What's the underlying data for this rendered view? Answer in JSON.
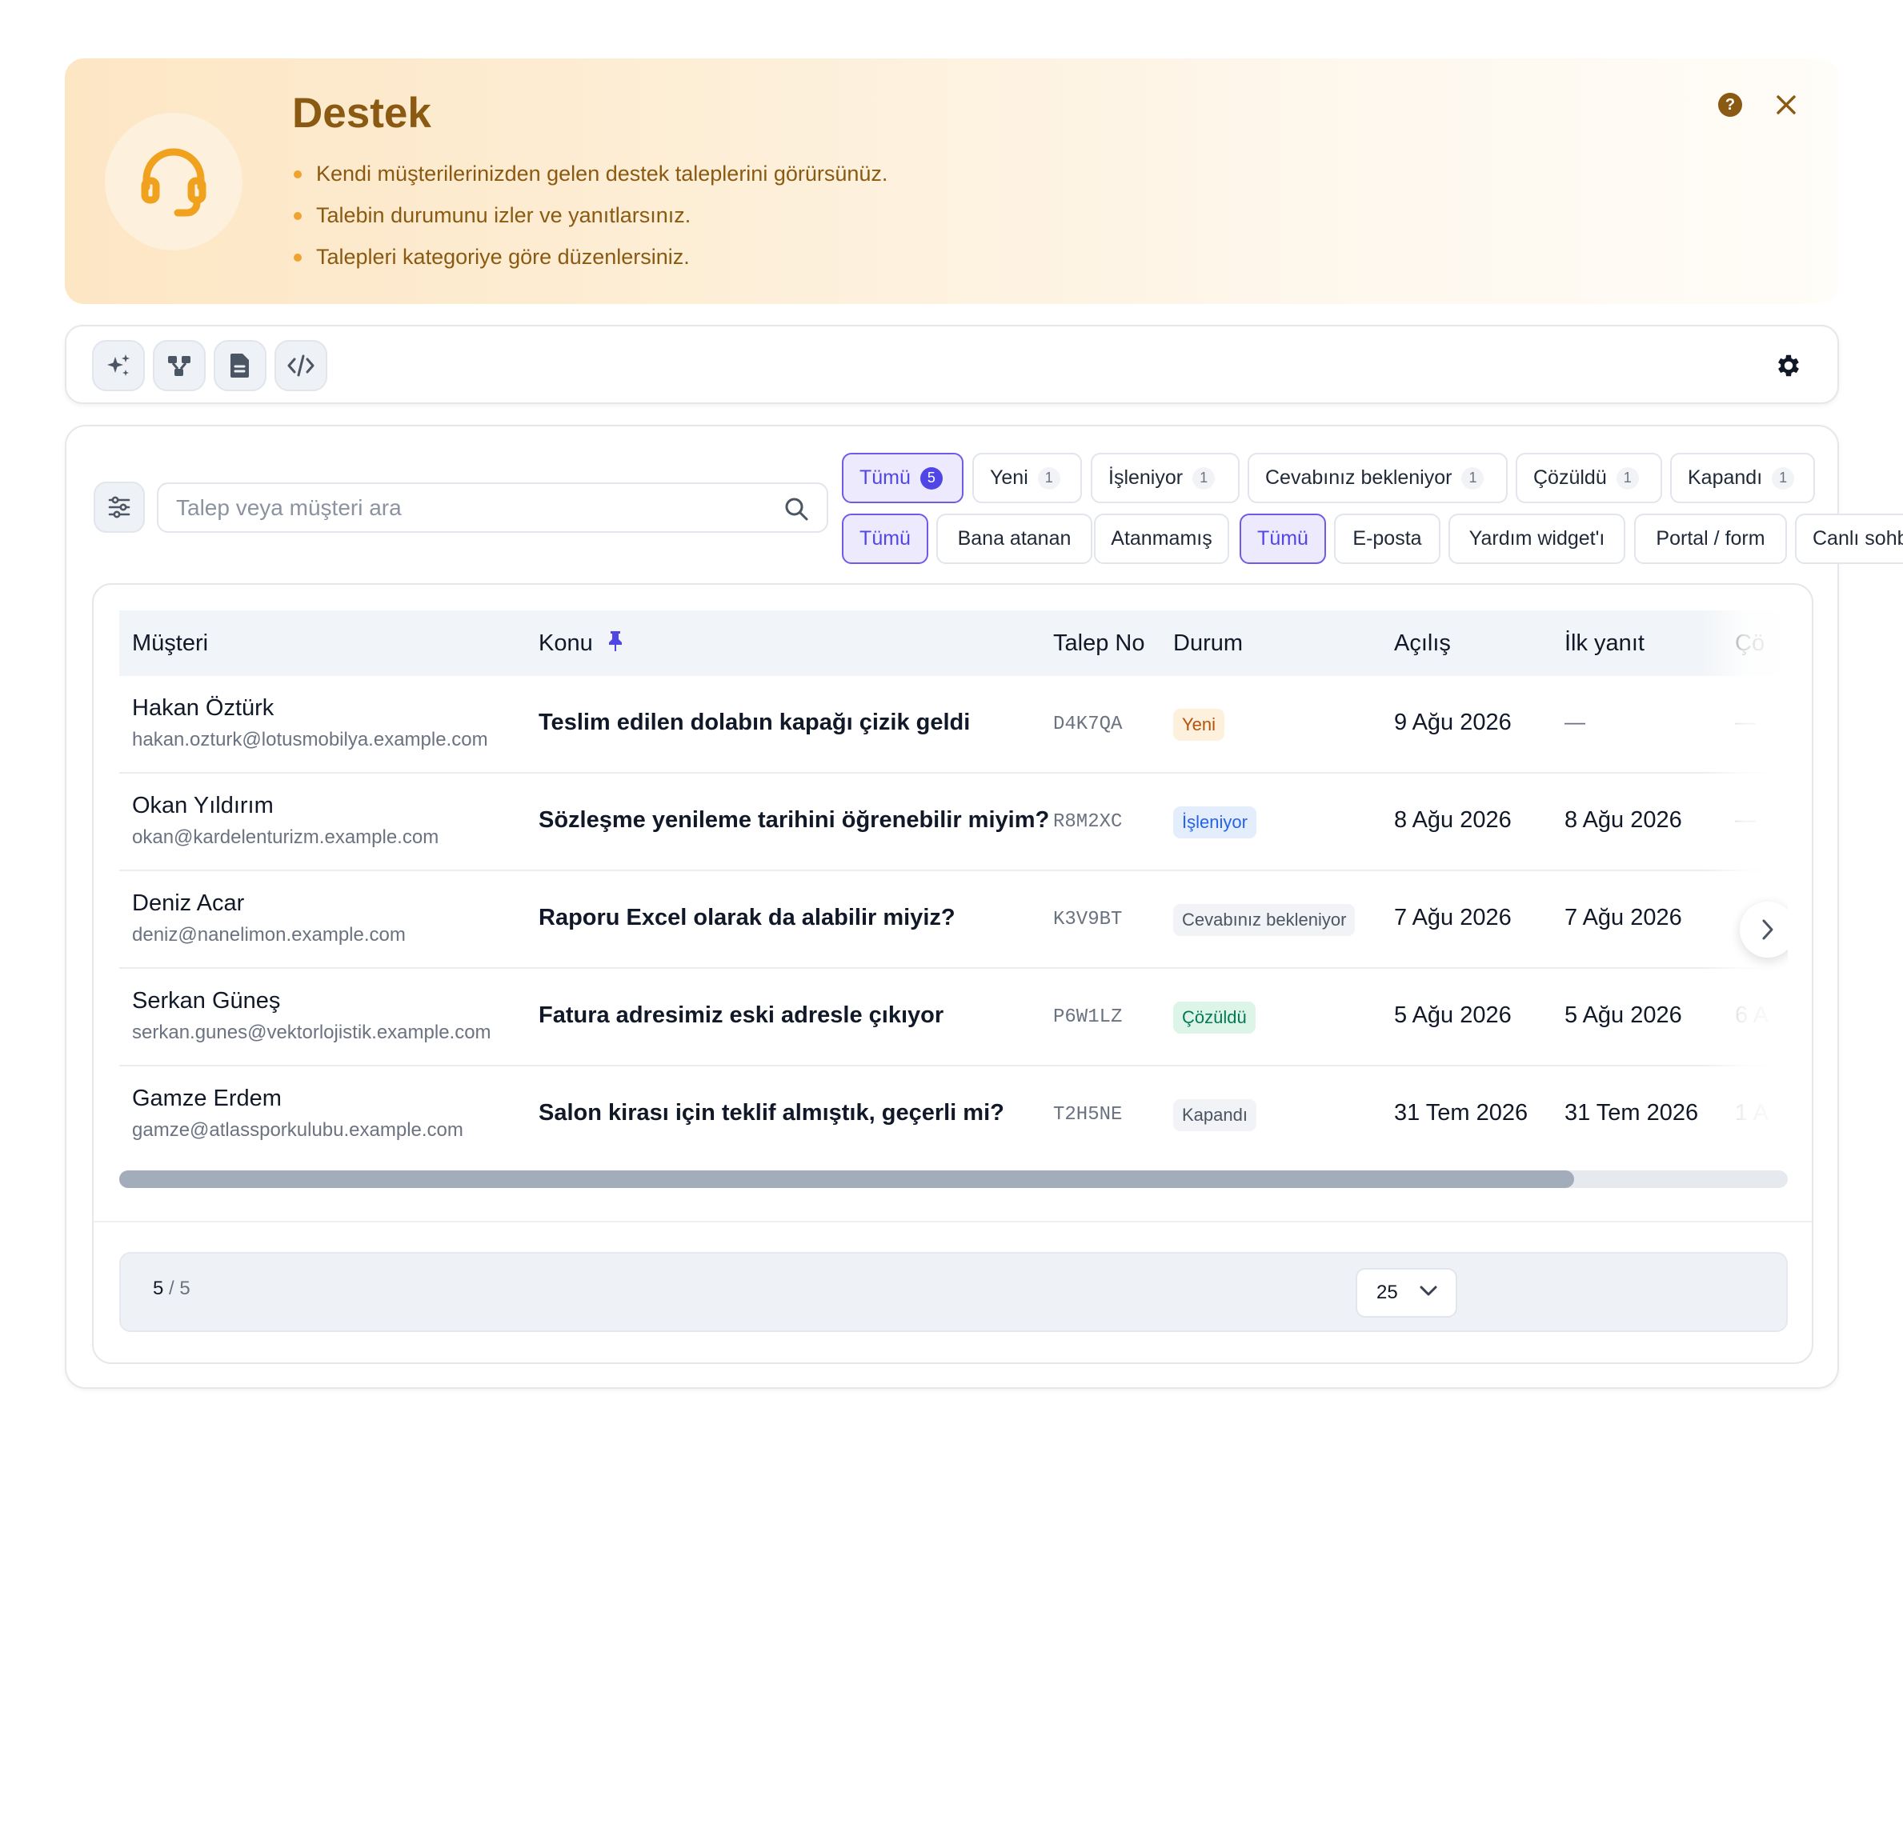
{
  "hero": {
    "title": "Destek",
    "bullets": [
      "Kendi müşterilerinizden gelen destek taleplerini görürsünüz.",
      "Talebin durumunu izler ve yanıtlarsınız.",
      "Talepleri kategoriye göre düzenlersiniz."
    ],
    "icon": "headset-icon",
    "help_icon_text": "?"
  },
  "toolbar": {
    "tools": [
      "sparkle-icon",
      "workflow-icon",
      "document-icon",
      "code-icon"
    ],
    "settings_icon": "gear-icon"
  },
  "search": {
    "placeholder": "Talep veya müşteri ara"
  },
  "status_filters": [
    {
      "label": "Tümü",
      "count": "5",
      "active": true
    },
    {
      "label": "Yeni",
      "count": "1",
      "active": false
    },
    {
      "label": "İşleniyor",
      "count": "1",
      "active": false
    },
    {
      "label": "Cevabınız bekleniyor",
      "count": "1",
      "active": false
    },
    {
      "label": "Çözüldü",
      "count": "1",
      "active": false
    },
    {
      "label": "Kapandı",
      "count": "1",
      "active": false
    }
  ],
  "assign_filters": [
    {
      "label": "Tümü",
      "active": true
    },
    {
      "label": "Bana atanan",
      "active": false
    },
    {
      "label": "Atanmamış",
      "active": false
    }
  ],
  "channel_filters": [
    {
      "label": "Tümü",
      "active": true
    },
    {
      "label": "E-posta",
      "active": false
    },
    {
      "label": "Yardım widget'ı",
      "active": false
    },
    {
      "label": "Portal / form",
      "active": false
    },
    {
      "label": "Canlı sohb",
      "active": false
    }
  ],
  "table": {
    "columns": [
      "Müşteri",
      "Konu",
      "Talep No",
      "Durum",
      "Açılış",
      "İlk yanıt",
      "Çö"
    ],
    "pinned_icon": "pin-icon",
    "rows": [
      {
        "name": "Hakan Öztürk",
        "email": "hakan.ozturk@lotusmobilya.example.com",
        "subject": "Teslim edilen dolabın kapağı çizik geldi",
        "ticket": "D4K7QA",
        "status": "Yeni",
        "status_bg": "#fdf0dc",
        "status_color": "#b45309",
        "opened": "9 Ağu 2026",
        "first_reply": "—",
        "resolved": "—"
      },
      {
        "name": "Okan Yıldırım",
        "email": "okan@kardelenturizm.example.com",
        "subject": "Sözleşme yenileme tarihini öğrenebilir miyim?",
        "ticket": "R8M2XC",
        "status": "İşleniyor",
        "status_bg": "#e3edfc",
        "status_color": "#2563eb",
        "opened": "8 Ağu 2026",
        "first_reply": "8 Ağu 2026",
        "resolved": "—"
      },
      {
        "name": "Deniz Acar",
        "email": "deniz@nanelimon.example.com",
        "subject": "Raporu Excel olarak da alabilir miyiz?",
        "ticket": "K3V9BT",
        "status": "Cevabınız bekleniyor",
        "status_bg": "#f1f3f6",
        "status_color": "#4b5563",
        "opened": "7 Ağu 2026",
        "first_reply": "7 Ağu 2026",
        "resolved": ""
      },
      {
        "name": "Serkan Güneş",
        "email": "serkan.gunes@vektorlojistik.example.com",
        "subject": "Fatura adresimiz eski adresle çıkıyor",
        "ticket": "P6W1LZ",
        "status": "Çözüldü",
        "status_bg": "#dcf5e8",
        "status_color": "#047857",
        "opened": "5 Ağu 2026",
        "first_reply": "5 Ağu 2026",
        "resolved": "6 A"
      },
      {
        "name": "Gamze Erdem",
        "email": "gamze@atlassporkulubu.example.com",
        "subject": "Salon kirası için teklif almıştık, geçerli mi?",
        "ticket": "T2H5NE",
        "status": "Kapandı",
        "status_bg": "#f1f3f6",
        "status_color": "#4b5563",
        "opened": "31 Tem 2026",
        "first_reply": "31 Tem 2026",
        "resolved": "1 A"
      }
    ],
    "scroll_fraction": 0.872
  },
  "pagination": {
    "shown": "5",
    "separator": "/",
    "total": "5",
    "page_size": "25"
  }
}
